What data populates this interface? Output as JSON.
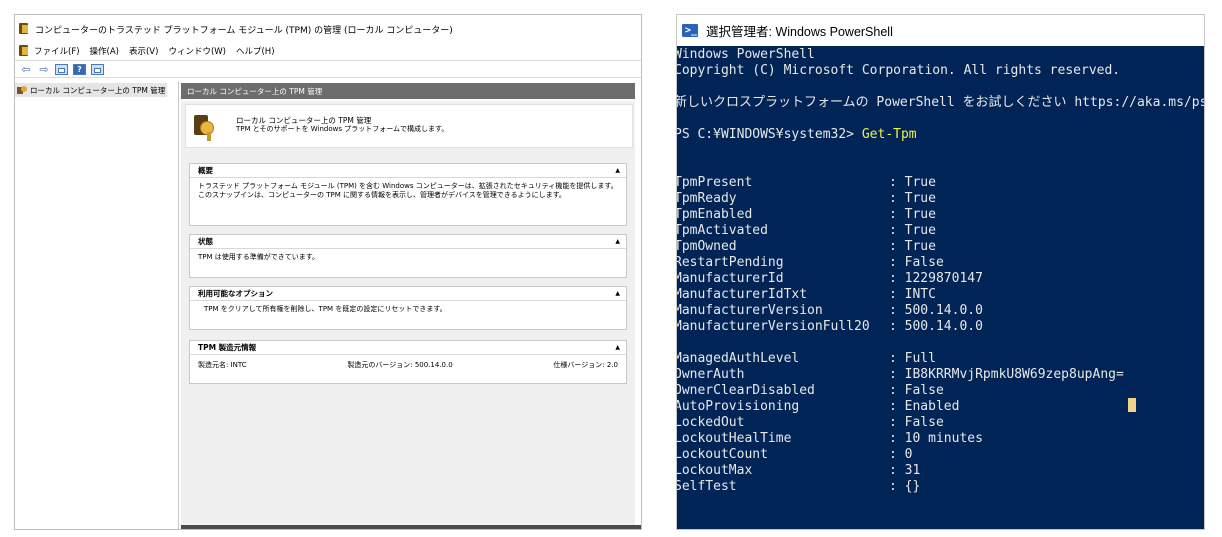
{
  "mmc": {
    "title": "コンピューターのトラステッド プラットフォーム モジュール (TPM) の管理 (ローカル コンピューター)",
    "menu": [
      "ファイル(F)",
      "操作(A)",
      "表示(V)",
      "ウィンドウ(W)",
      "ヘルプ(H)"
    ],
    "toolbar": {
      "back_icon": "back-arrow-icon",
      "forward_icon": "forward-arrow-icon",
      "help_glyph": "?"
    },
    "tree": {
      "item_label": "ローカル コンピューター上の TPM 管理"
    },
    "main": {
      "header": "ローカル コンピューター上の TPM 管理",
      "intro_title": "ローカル コンピューター上の TPM 管理",
      "intro_desc": "TPM とそのサポートを Windows プラットフォームで構成します。",
      "sections": {
        "overview": {
          "title": "概要",
          "text": "トラステッド プラットフォーム モジュール (TPM) を含む Windows コンピューターは、拡張されたセキュリティ機能を提供します。このスナップインは、コンピューターの TPM に関する情報を表示し、管理者がデバイスを管理できるようにします。"
        },
        "status": {
          "title": "状態",
          "text": "TPM は使用する準備ができています。"
        },
        "options": {
          "title": "利用可能なオプション",
          "text": "TPM をクリアして所有権を削除し、TPM を既定の設定にリセットできます。"
        },
        "manufacturer": {
          "title": "TPM 製造元情報",
          "name": "製造元名: INTC",
          "version": "製造元のバージョン: 500.14.0.0",
          "spec": "仕様バージョン: 2.0"
        }
      },
      "caret": "▲"
    }
  },
  "powershell": {
    "title": "選択管理者: Windows PowerShell",
    "banner_1": "Windows PowerShell",
    "banner_2": "Copyright (C) Microsoft Corporation. All rights reserved.",
    "banner_3": "新しいクロスプラットフォームの PowerShell をお試しください https://aka.ms/pscore6",
    "prompt": "PS C:¥WINDOWS¥system32> ",
    "command": "Get-Tpm",
    "output": [
      {
        "key": "TpmPresent",
        "value": "True"
      },
      {
        "key": "TpmReady",
        "value": "True"
      },
      {
        "key": "TpmEnabled",
        "value": "True"
      },
      {
        "key": "TpmActivated",
        "value": "True"
      },
      {
        "key": "TpmOwned",
        "value": "True"
      },
      {
        "key": "RestartPending",
        "value": "False"
      },
      {
        "key": "ManufacturerId",
        "value": "1229870147"
      },
      {
        "key": "ManufacturerIdTxt",
        "value": "INTC"
      },
      {
        "key": "ManufacturerVersion",
        "value": "500.14.0.0"
      },
      {
        "key": "ManufacturerVersionFull20",
        "value": "500.14.0.0"
      },
      {
        "key": "ManagedAuthLevel",
        "value": "Full"
      },
      {
        "key": "OwnerAuth",
        "value": "IB8KRRMvjRpmkU8W69zep8upAng="
      },
      {
        "key": "OwnerClearDisabled",
        "value": "False"
      },
      {
        "key": "AutoProvisioning",
        "value": "Enabled"
      },
      {
        "key": "LockedOut",
        "value": "False"
      },
      {
        "key": "LockoutHealTime",
        "value": "10 minutes"
      },
      {
        "key": "LockoutCount",
        "value": "0"
      },
      {
        "key": "LockoutMax",
        "value": "31"
      },
      {
        "key": "SelfTest",
        "value": "{}"
      }
    ],
    "separator": ": ",
    "colors": {
      "background": "#012456",
      "text": "#e8e8e8",
      "command": "#f3f04a"
    }
  }
}
